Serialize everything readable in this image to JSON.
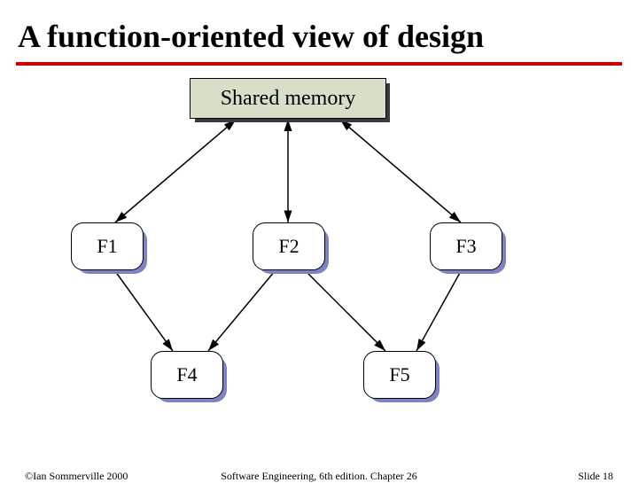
{
  "title": "A function-oriented view of design",
  "shared_label": "Shared memory",
  "nodes": {
    "f1": "F1",
    "f2": "F2",
    "f3": "F3",
    "f4": "F4",
    "f5": "F5"
  },
  "edges": [
    [
      "shared",
      "f1",
      "both"
    ],
    [
      "shared",
      "f2",
      "both"
    ],
    [
      "shared",
      "f3",
      "both"
    ],
    [
      "f1",
      "f4",
      "fwd"
    ],
    [
      "f2",
      "f4",
      "fwd"
    ],
    [
      "f2",
      "f5",
      "fwd"
    ],
    [
      "f3",
      "f5",
      "fwd"
    ]
  ],
  "footer": {
    "left": "©Ian Sommerville 2000",
    "center": "Software Engineering, 6th edition. Chapter 26",
    "right": "Slide 18"
  }
}
